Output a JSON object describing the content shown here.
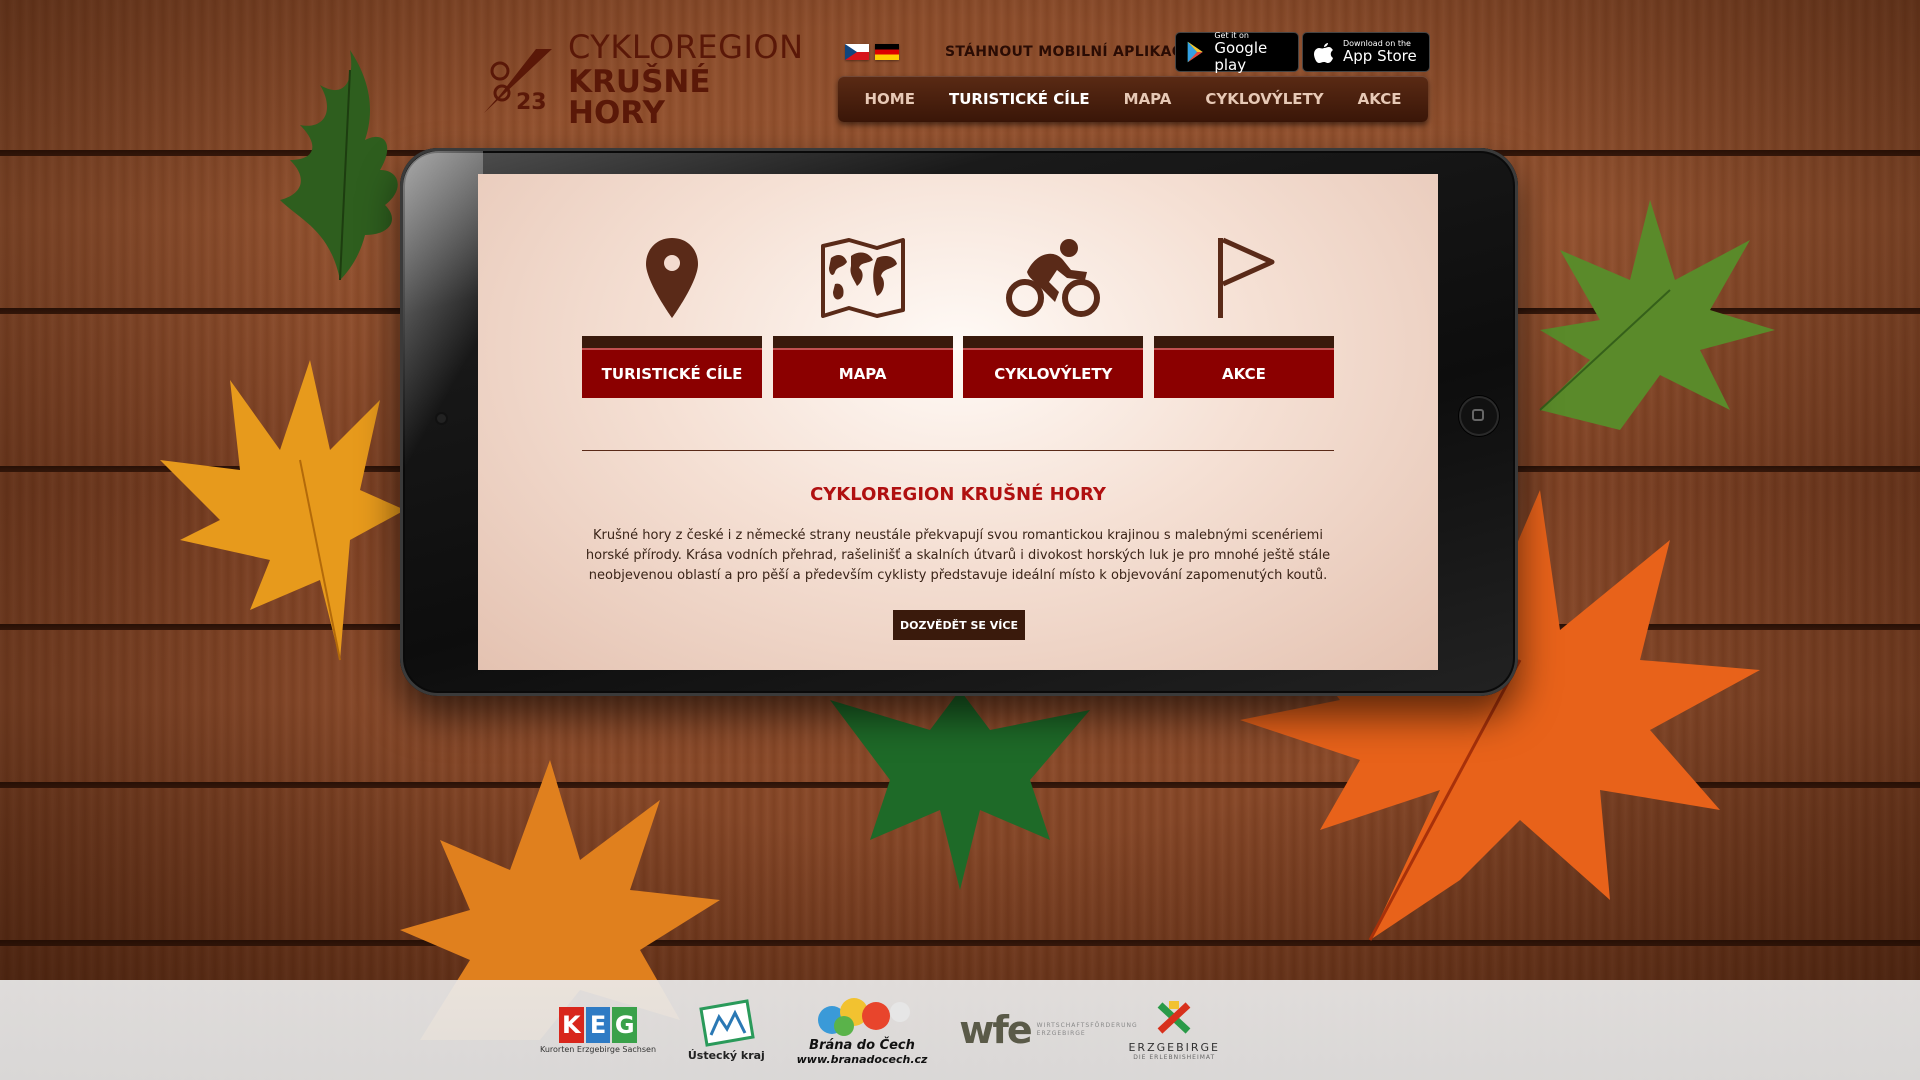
{
  "brand": {
    "logo_number": "23",
    "line1": "CYKLOREGION",
    "line2": "KRUŠNÉ HORY"
  },
  "header": {
    "languages": [
      "cz-flag",
      "de-flag"
    ],
    "app_label": "STÁHNOUT MOBILNÍ APLIKACI",
    "google_play": {
      "small": "Get it on",
      "big": "Google play"
    },
    "app_store": {
      "small": "Download on the",
      "big": "App Store"
    }
  },
  "nav": {
    "items": [
      {
        "label": "HOME",
        "active": false
      },
      {
        "label": "TURISTICKÉ CÍLE",
        "active": true
      },
      {
        "label": "MAPA",
        "active": false
      },
      {
        "label": "CYKLOVÝLETY",
        "active": false
      },
      {
        "label": "AKCE",
        "active": false
      }
    ]
  },
  "cards": [
    {
      "label": "TURISTICKÉ CÍLE",
      "icon": "map-pin-icon"
    },
    {
      "label": "MAPA",
      "icon": "world-map-icon"
    },
    {
      "label": "CYKLOVÝLETY",
      "icon": "cyclist-icon"
    },
    {
      "label": "AKCE",
      "icon": "flag-icon"
    }
  ],
  "intro": {
    "title": "CYKLOREGION KRUŠNÉ HORY",
    "text": "Krušné hory z české i z německé strany neustále překvapují svou romantickou krajinou s malebnými scenériemi horské přírody. Krása vodních přehrad, rašelinišť a skalních útvarů i divokost horských luk je pro mnohé ještě stále neobjevenou oblastí a pro pěší a především cyklisty představuje ideální místo k objevování zapomenutých koutů.",
    "button": "DOZVĚDĚT SE VÍCE"
  },
  "partners": {
    "keg": {
      "letters": [
        "K",
        "E",
        "G"
      ],
      "caption": "Kurorten Erzgebirge Sachsen"
    },
    "ustecky": {
      "label": "Ústecký kraj"
    },
    "brana": {
      "label": "Brána do Čech",
      "url": "www.branadocech.cz"
    },
    "wfe": {
      "label": "wfe",
      "sub": "WIRTSCHAFTSFÖRDERUNG ERZGEBIRGE"
    },
    "erzgebirge": {
      "label": "ERZGEBIRGE",
      "sub": "DIE ERLEBNISHEIMAT"
    }
  },
  "colors": {
    "accent_red": "#8b0000",
    "dark_brown": "#3a1a0c",
    "title_red": "#b01010"
  }
}
